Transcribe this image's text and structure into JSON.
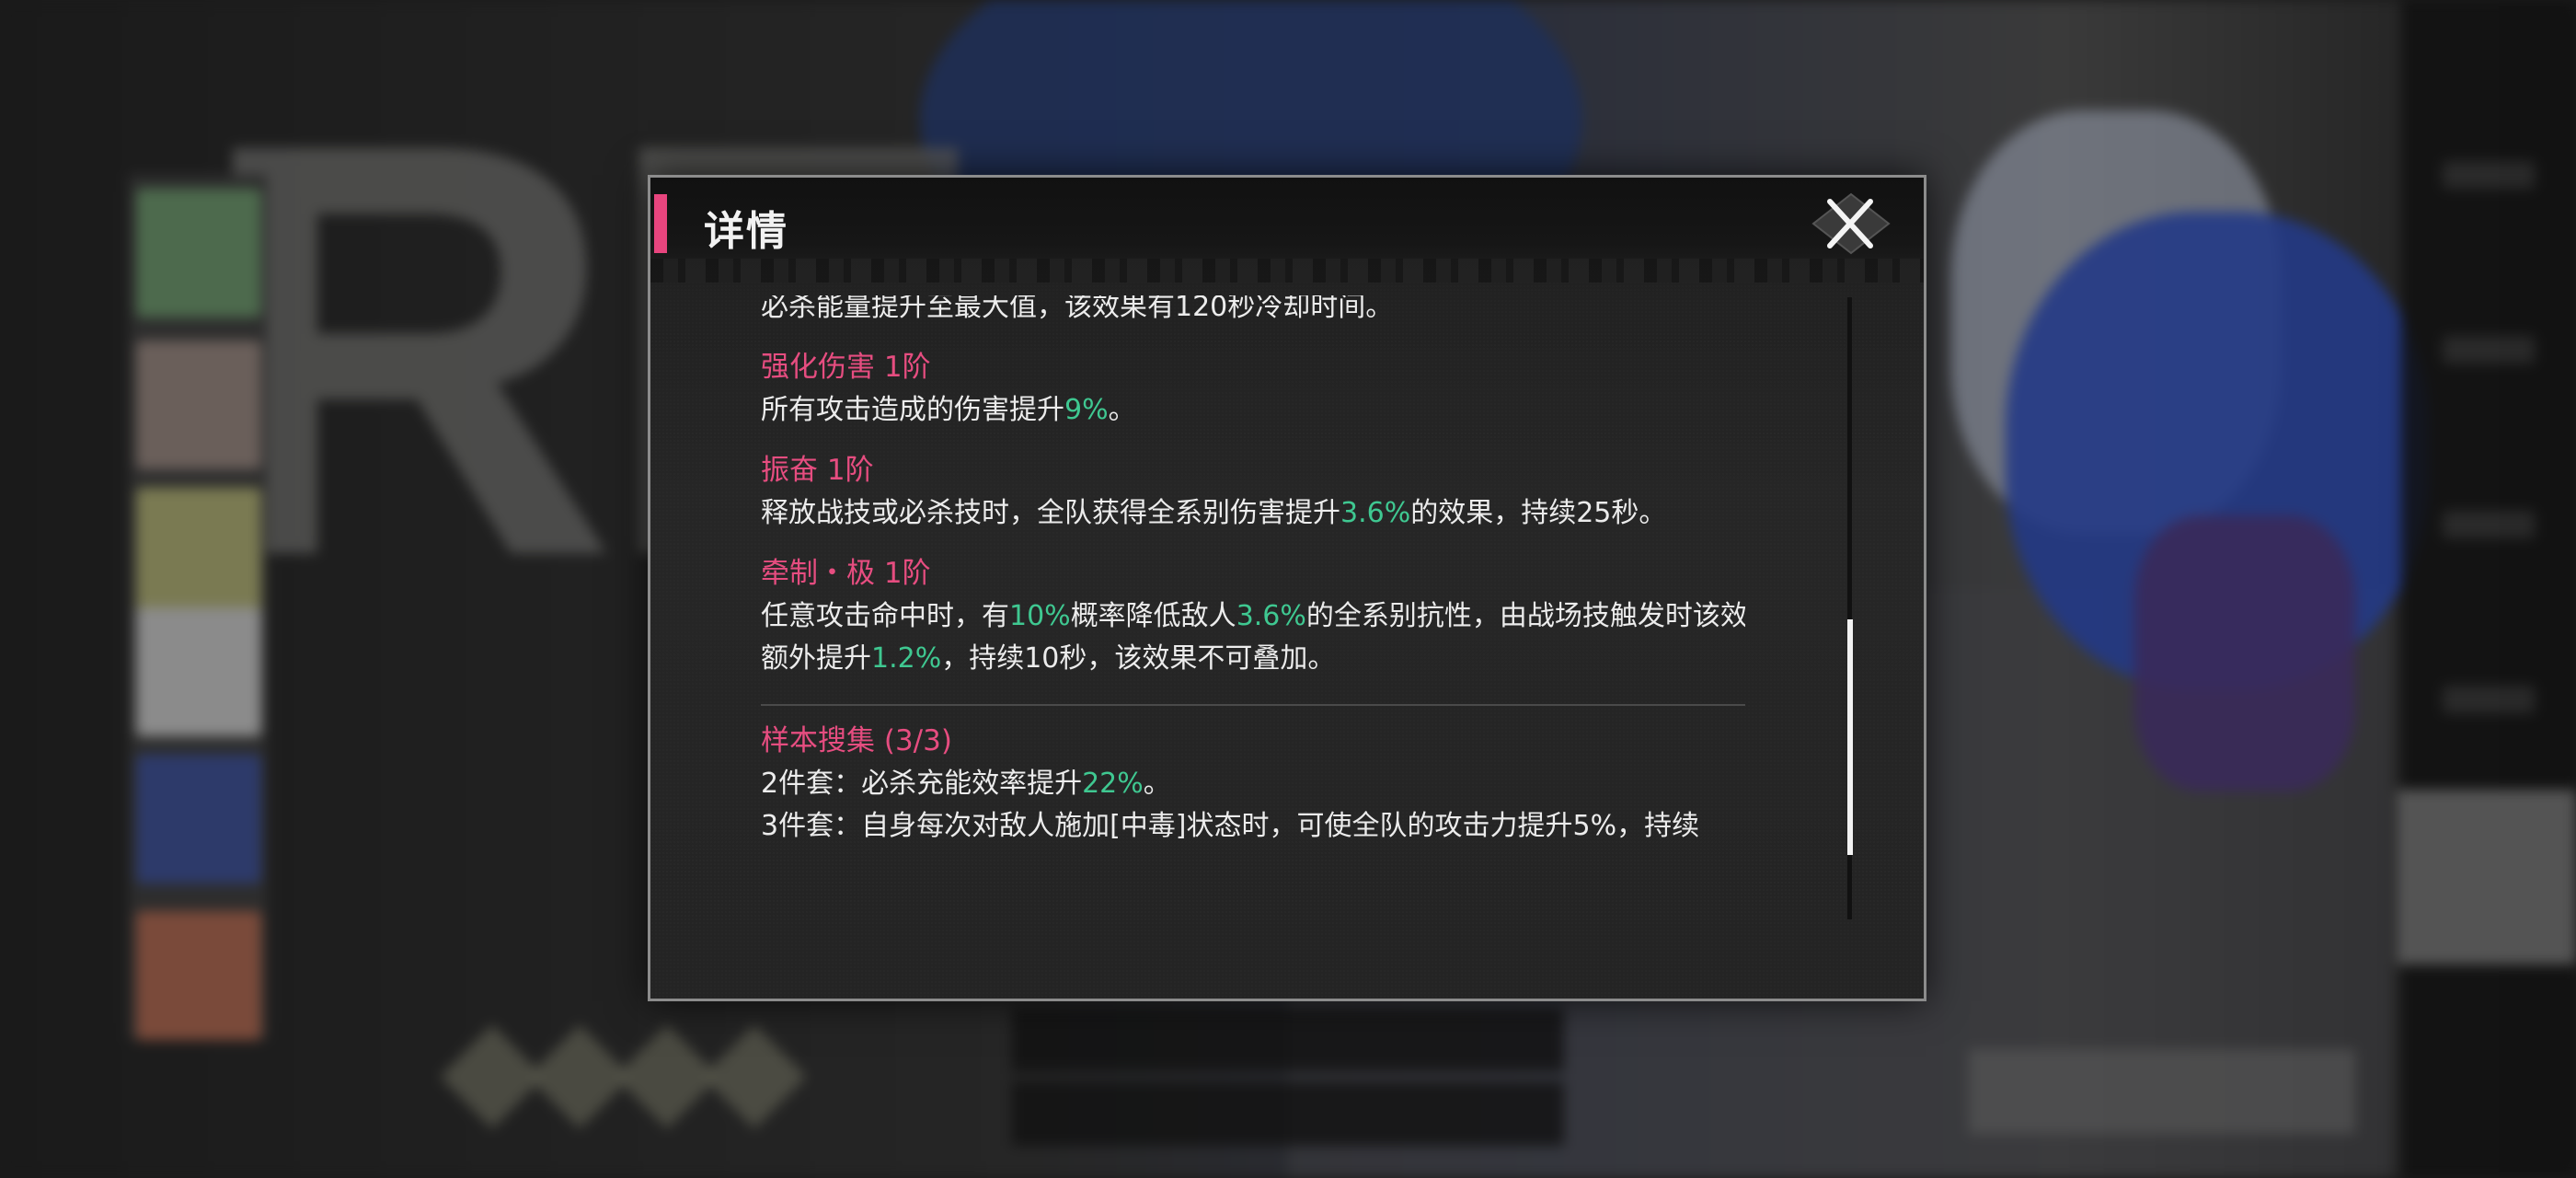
{
  "modal": {
    "title": "详情",
    "close_label": "close"
  },
  "top_line": "必杀能量提升至最大值，该效果有120秒冷却时间。",
  "effects": [
    {
      "name": "强化伤害 1阶",
      "desc": [
        {
          "text": "所有攻击造成的伤害提升",
          "hl": false
        },
        {
          "text": "9%",
          "hl": true
        },
        {
          "text": "。",
          "hl": false
        }
      ]
    },
    {
      "name": "振奋 1阶",
      "desc": [
        {
          "text": "释放战技或必杀技时，全队获得全系别伤害提升",
          "hl": false
        },
        {
          "text": "3.6%",
          "hl": true
        },
        {
          "text": "的效果，持续25秒。",
          "hl": false
        }
      ]
    },
    {
      "name": "牵制・极 1阶",
      "desc": [
        {
          "text": "任意攻击命中时，有",
          "hl": false
        },
        {
          "text": "10%",
          "hl": true
        },
        {
          "text": "概率降低敌人",
          "hl": false
        },
        {
          "text": "3.6%",
          "hl": true
        },
        {
          "text": "的全系别抗性，由战场技触发时该效果",
          "hl": false
        }
      ],
      "desc2": [
        {
          "text": "额外提升",
          "hl": false
        },
        {
          "text": "1.2%",
          "hl": true
        },
        {
          "text": "，持续10秒，该效果不可叠加。",
          "hl": false
        }
      ]
    }
  ],
  "set_bonus": {
    "name": "样本搜集 (3/3)",
    "line1": [
      {
        "text": "2件套：必杀充能效率提升",
        "hl": false
      },
      {
        "text": "22%",
        "hl": true
      },
      {
        "text": "。",
        "hl": false
      }
    ],
    "line2_partial": "3件套：自身每次对敌人施加[中毒]状态时，可使全队的攻击力提升5%，持续"
  },
  "colors": {
    "accent_pink": "#e8457e",
    "highlight_green": "#3fc891",
    "text": "#ececec"
  }
}
